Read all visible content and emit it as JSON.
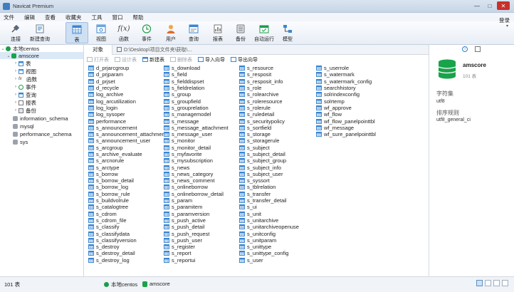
{
  "window": {
    "title": "Navicat Premium",
    "min": "—",
    "max": "□",
    "close": "✕"
  },
  "menu": [
    "文件",
    "编辑",
    "查看",
    "收藏夹",
    "工具",
    "窗口",
    "帮助"
  ],
  "toolbar": {
    "buttons": [
      {
        "label": "连接",
        "icon": "plug-icon"
      },
      {
        "label": "新建查询",
        "icon": "new-query-icon"
      },
      {
        "label": "表",
        "icon": "table-icon"
      },
      {
        "label": "视图",
        "icon": "view-icon"
      },
      {
        "label": "函数",
        "icon": "function-icon"
      },
      {
        "label": "事件",
        "icon": "clock-icon"
      },
      {
        "label": "用户",
        "icon": "user-icon"
      },
      {
        "label": "查询",
        "icon": "query-icon"
      },
      {
        "label": "报表",
        "icon": "report-icon"
      },
      {
        "label": "备份",
        "icon": "backup-icon"
      },
      {
        "label": "自动运行",
        "icon": "schedule-icon"
      },
      {
        "label": "模型",
        "icon": "model-icon"
      }
    ],
    "login": "登录"
  },
  "sidebar": {
    "connection": "本地centos",
    "database": "amscore",
    "children": [
      "表",
      "视图",
      "函数",
      "事件",
      "查询",
      "报表",
      "备份"
    ],
    "other_dbs": [
      "information_schema",
      "mysql",
      "performance_schema",
      "sys"
    ]
  },
  "tabs": {
    "objects": "对象",
    "path": "D:\\Desktop\\项目文件夹\\获取\\..."
  },
  "objbar": [
    "打开表",
    "设计表",
    "新建表",
    "删除表",
    "导入向导",
    "导出向导"
  ],
  "tables": {
    "col1": [
      "d_prjarcgroup",
      "d_prjparam",
      "d_prjset",
      "d_recycle",
      "log_archive",
      "log_arcutilization",
      "log_login",
      "log_sysoper",
      "performance",
      "s_announcement",
      "s_announcement_attachment",
      "s_announcement_user",
      "s_arcgroup",
      "s_archive_evaluate",
      "s_arcnorule",
      "s_arctype",
      "s_borrow",
      "s_borrow_detail",
      "s_borrow_log",
      "s_borrow_rule",
      "s_buildvolrule",
      "s_catalogtree",
      "s_cdrom",
      "s_cdrom_file",
      "s_classify",
      "s_classifydata",
      "s_classifyversion",
      "s_destroy",
      "s_destroy_detail",
      "s_destroy_log"
    ],
    "col2": [
      "s_download",
      "s_field",
      "s_fielddispset",
      "s_fieldrelation",
      "s_group",
      "s_groupfield",
      "s_grouprelation",
      "s_managemodel",
      "s_message",
      "s_message_attachment",
      "s_message_user",
      "s_monitor",
      "s_monitor_detail",
      "s_myfavorite",
      "s_mysubscription",
      "s_news",
      "s_news_category",
      "s_news_comment",
      "s_onlineborrow",
      "s_onlineborrow_detail",
      "s_param",
      "s_paramitem",
      "s_paramversion",
      "s_push_active",
      "s_push_detail",
      "s_push_request",
      "s_push_user",
      "s_register",
      "s_report",
      "s_reportui"
    ],
    "col3": [
      "s_resource",
      "s_resposit",
      "s_resposit_info",
      "s_role",
      "s_rolearchive",
      "s_roleresource",
      "s_rolerule",
      "s_ruledetail",
      "s_securitypolicy",
      "s_sortfield",
      "s_storage",
      "s_storagerule",
      "s_subject",
      "s_subject_detail",
      "s_subject_group",
      "s_subject_info",
      "s_subject_user",
      "s_syssort",
      "s_tblrelation",
      "s_transfer",
      "s_transfer_detail",
      "s_ui",
      "s_unit",
      "s_unitarchive",
      "s_unitarchiveopenuse",
      "s_unitconfig",
      "s_unitparam",
      "s_unittype",
      "s_unittype_config",
      "s_user"
    ],
    "col4": [
      "s_userrole",
      "s_watermark",
      "s_watermark_config",
      "searchhistory",
      "solrindexconfig",
      "solrtemp",
      "wf_approve",
      "wf_flow",
      "wf_flow_panelpointtbl",
      "wf_message",
      "wf_sure_panelpointtbl"
    ]
  },
  "info": {
    "name": "amscore",
    "count": "101 表",
    "charset_label": "字符集",
    "charset": "utf8",
    "collation_label": "排序规则",
    "collation": "utf8_general_ci"
  },
  "status": {
    "count": "101 表",
    "connection": "本地centos",
    "database": "amscore"
  },
  "colors": {
    "accent": "#2f7fd0",
    "db_green": "#19a34a",
    "table_blue": "#3b86d1"
  }
}
